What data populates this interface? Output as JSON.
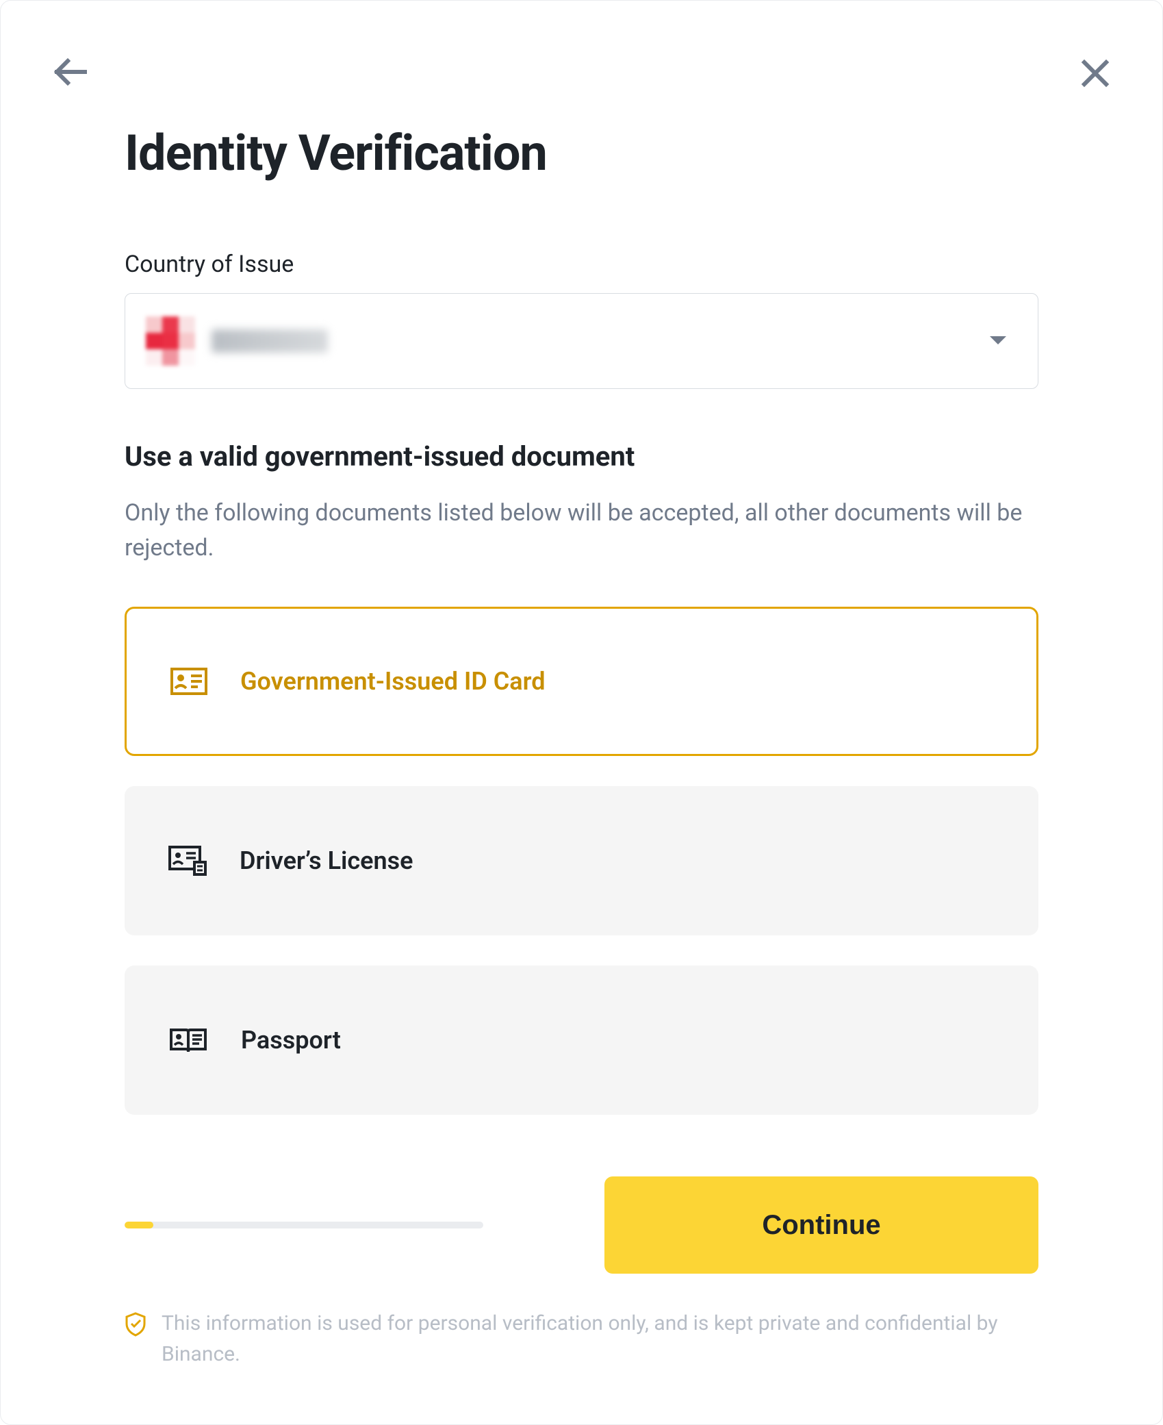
{
  "header": {
    "title": "Identity Verification"
  },
  "country": {
    "label": "Country of Issue",
    "selected_redacted": true
  },
  "document_section": {
    "heading": "Use a valid government-issued document",
    "description": "Only the following documents listed below will be accepted, all other documents will be rejected."
  },
  "documents": [
    {
      "id": "id-card",
      "label": "Government-Issued ID Card",
      "icon": "id-card-icon",
      "selected": true
    },
    {
      "id": "drivers-license",
      "label": "Driver’s License",
      "icon": "drivers-license-icon",
      "selected": false
    },
    {
      "id": "passport",
      "label": "Passport",
      "icon": "passport-icon",
      "selected": false
    }
  ],
  "progress": {
    "percent": 8
  },
  "actions": {
    "continue_label": "Continue"
  },
  "privacy": {
    "text": "This information is used for personal verification only, and is kept private and confidential by Binance."
  },
  "colors": {
    "accent": "#fcd535",
    "accent_border": "#e2a500",
    "text_primary": "#1e2329",
    "text_secondary": "#707a8a",
    "text_muted": "#b7bdc6",
    "surface_muted": "#f5f5f5"
  }
}
